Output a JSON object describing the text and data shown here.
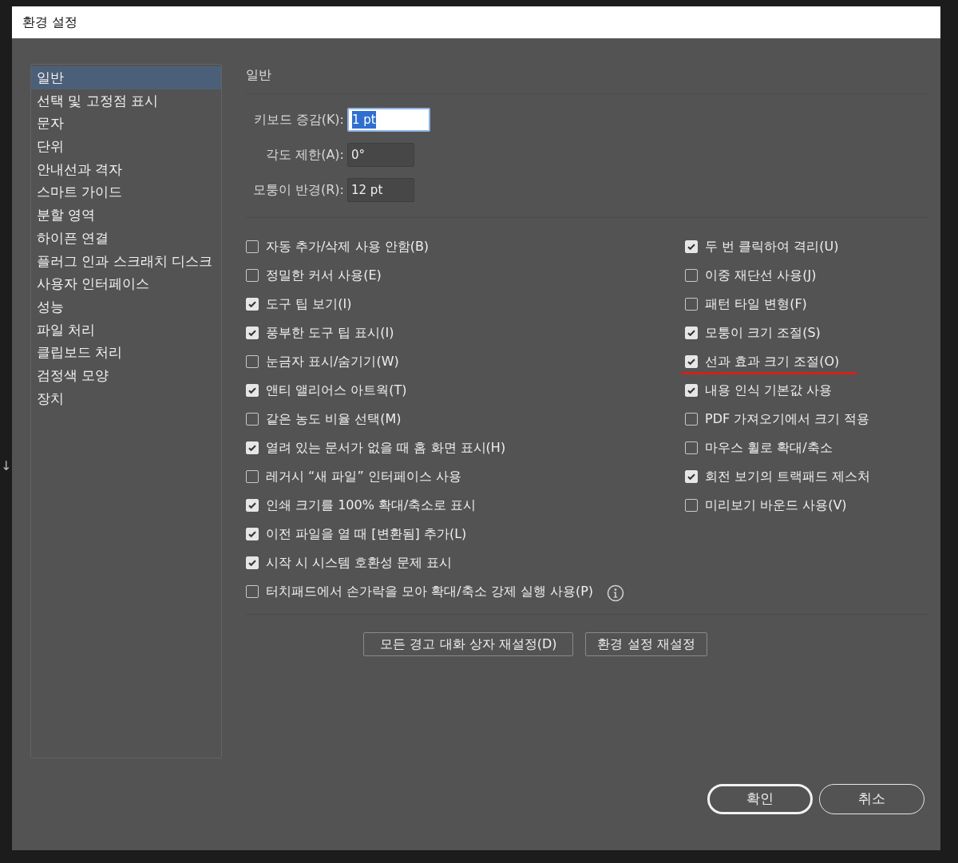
{
  "background": {
    "arrow": "↓"
  },
  "window": {
    "title": "환경 설정"
  },
  "sidebar": {
    "items": [
      {
        "label": "일반",
        "selected": true
      },
      {
        "label": "선택 및 고정점 표시",
        "selected": false
      },
      {
        "label": "문자",
        "selected": false
      },
      {
        "label": "단위",
        "selected": false
      },
      {
        "label": "안내선과 격자",
        "selected": false
      },
      {
        "label": "스마트 가이드",
        "selected": false
      },
      {
        "label": "분할 영역",
        "selected": false
      },
      {
        "label": "하이픈 연결",
        "selected": false
      },
      {
        "label": "플러그 인과 스크래치 디스크",
        "selected": false
      },
      {
        "label": "사용자 인터페이스",
        "selected": false
      },
      {
        "label": "성능",
        "selected": false
      },
      {
        "label": "파일 처리",
        "selected": false
      },
      {
        "label": "클립보드 처리",
        "selected": false
      },
      {
        "label": "검정색 모양",
        "selected": false
      },
      {
        "label": "장치",
        "selected": false
      }
    ]
  },
  "section_title": "일반",
  "fields": [
    {
      "label": "키보드 증감(K):",
      "value": "1 pt",
      "focused": true
    },
    {
      "label": "각도 제한(A):",
      "value": "0°",
      "focused": false
    },
    {
      "label": "모퉁이 반경(R):",
      "value": "12 pt",
      "focused": false
    }
  ],
  "options_left": [
    {
      "label": "자동 추가/삭제 사용 안함(B)",
      "checked": false
    },
    {
      "label": "정밀한 커서 사용(E)",
      "checked": false
    },
    {
      "label": "도구 팁 보기(I)",
      "checked": true
    },
    {
      "label": "풍부한 도구 팁 표시(I)",
      "checked": true
    },
    {
      "label": "눈금자 표시/숨기기(W)",
      "checked": false
    },
    {
      "label": "앤티 앨리어스 아트웍(T)",
      "checked": true
    },
    {
      "label": "같은 농도 비율 선택(M)",
      "checked": false
    },
    {
      "label": "열려 있는 문서가 없을 때 홈 화면 표시(H)",
      "checked": true
    },
    {
      "label": "레거시 “새 파일” 인터페이스 사용",
      "checked": false
    },
    {
      "label": "인쇄 크기를 100% 확대/축소로 표시",
      "checked": true
    },
    {
      "label": "이전 파일을 열 때 [변환됨] 추가(L)",
      "checked": true
    },
    {
      "label": "시작 시 시스템 호환성 문제 표시",
      "checked": true
    },
    {
      "label": "터치패드에서 손가락을 모아 확대/축소 강제 실행 사용(P)",
      "checked": false,
      "info": true
    }
  ],
  "options_right": [
    {
      "label": "두 번 클릭하여 격리(U)",
      "checked": true
    },
    {
      "label": "이중 재단선 사용(J)",
      "checked": false
    },
    {
      "label": "패턴 타일 변형(F)",
      "checked": false
    },
    {
      "label": "모퉁이 크기 조절(S)",
      "checked": true
    },
    {
      "label": "선과 효과 크기 조절(O)",
      "checked": true,
      "underlined": true
    },
    {
      "label": "내용 인식 기본값 사용",
      "checked": true
    },
    {
      "label": "PDF 가져오기에서 크기 적용",
      "checked": false
    },
    {
      "label": "마우스 휠로 확대/축소",
      "checked": false
    },
    {
      "label": "회전 보기의 트랙패드 제스처",
      "checked": true
    },
    {
      "label": "미리보기 바운드 사용(V)",
      "checked": false
    }
  ],
  "reset_buttons": [
    "모든 경고 대화 상자 재설정(D)",
    "환경 설정 재설정"
  ],
  "footer_buttons": [
    {
      "label": "확인",
      "default": true
    },
    {
      "label": "취소",
      "default": false
    }
  ]
}
